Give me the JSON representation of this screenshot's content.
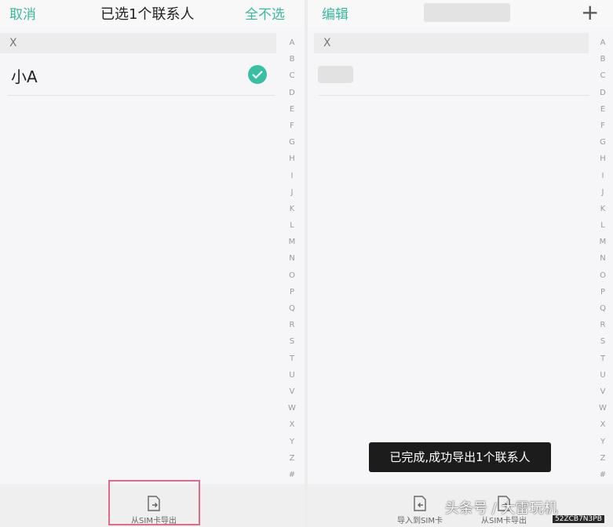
{
  "left": {
    "cancel_label": "取消",
    "title": "已选1个联系人",
    "deselect_all_label": "全不选",
    "section_letter": "X",
    "contact_name": "小A",
    "bottom_button_label": "从SIM卡导出"
  },
  "right": {
    "edit_label": "编辑",
    "add_label": "+",
    "section_letter": "X",
    "bottom_button_1_label": "导入到SIM卡",
    "bottom_button_2_label": "从SIM卡导出",
    "toast": "已完成,成功导出1个联系人"
  },
  "index_letters": [
    "A",
    "B",
    "C",
    "D",
    "E",
    "F",
    "G",
    "H",
    "I",
    "J",
    "K",
    "L",
    "M",
    "N",
    "O",
    "P",
    "Q",
    "R",
    "S",
    "T",
    "U",
    "V",
    "W",
    "X",
    "Y",
    "Z",
    "#"
  ],
  "watermark": "头条号 / 大雷玩机",
  "watermark_small": "52ZCB7N3PB",
  "colors": {
    "accent": "#39b8a0",
    "check": "#39c0a4",
    "highlight": "#e06a8a"
  },
  "icons": {
    "selected": "check-circle-icon",
    "sim": "sim-card-icon",
    "add": "plus-icon"
  }
}
